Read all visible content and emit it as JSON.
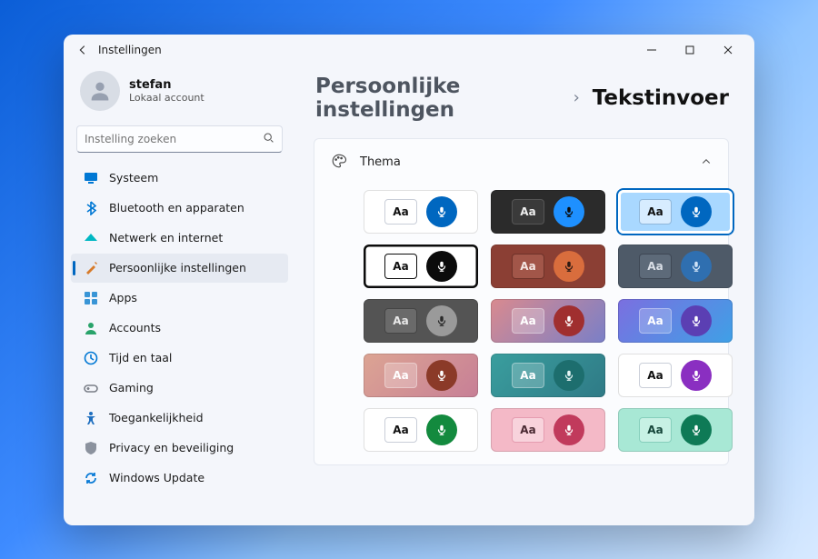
{
  "window": {
    "title": "Instellingen"
  },
  "profile": {
    "name": "stefan",
    "sub": "Lokaal account"
  },
  "search": {
    "placeholder": "Instelling zoeken"
  },
  "nav": [
    {
      "id": "systeem",
      "label": "Systeem",
      "icon": "monitor",
      "color": "#0078d4",
      "active": false
    },
    {
      "id": "bluetooth",
      "label": "Bluetooth en apparaten",
      "icon": "bluetooth",
      "color": "#0078d4",
      "active": false
    },
    {
      "id": "netwerk",
      "label": "Netwerk en internet",
      "icon": "wifi",
      "color": "#00b7c3",
      "active": false
    },
    {
      "id": "personal",
      "label": "Persoonlijke instellingen",
      "icon": "paint",
      "color": "#d77b2a",
      "active": true
    },
    {
      "id": "apps",
      "label": "Apps",
      "icon": "apps",
      "color": "#3995d6",
      "active": false
    },
    {
      "id": "accounts",
      "label": "Accounts",
      "icon": "person",
      "color": "#29a36a",
      "active": false
    },
    {
      "id": "tijd",
      "label": "Tijd en taal",
      "icon": "clock",
      "color": "#0078d4",
      "active": false
    },
    {
      "id": "gaming",
      "label": "Gaming",
      "icon": "gaming",
      "color": "#7a7f88",
      "active": false
    },
    {
      "id": "toegang",
      "label": "Toegankelijkheid",
      "icon": "access",
      "color": "#1f6fbf",
      "active": false
    },
    {
      "id": "privacy",
      "label": "Privacy en beveiliging",
      "icon": "shield",
      "color": "#8b929e",
      "active": false
    },
    {
      "id": "update",
      "label": "Windows Update",
      "icon": "update",
      "color": "#0a7bd6",
      "active": false
    }
  ],
  "breadcrumb": {
    "a": "Persoonlijke instellingen",
    "b": "Tekstinvoer"
  },
  "panel": {
    "title": "Thema"
  },
  "sample": "Aa",
  "themes": [
    {
      "bg": "#ffffff",
      "chipBg": "#ffffff",
      "chipFg": "#111",
      "chipBorder": "#c9ced8",
      "micBg": "#0067c0",
      "micFg": "#ffffff",
      "selected": false
    },
    {
      "bg": "#2b2b2b",
      "chipBg": "#3a3a3a",
      "chipFg": "#eee",
      "chipBorder": "#555",
      "micBg": "#1e90ff",
      "micFg": "#0b0b0b",
      "selected": false
    },
    {
      "bg": "#a9d8ff",
      "chipBg": "#d7ecff",
      "chipFg": "#111",
      "chipBorder": "#8fb7da",
      "micBg": "#0067c0",
      "micFg": "#ffffff",
      "selected": true
    },
    {
      "bg": "#ffffff",
      "chipBg": "#ffffff",
      "chipFg": "#111",
      "chipBorder": "#0b0b0b",
      "micBg": "#0b0b0b",
      "micFg": "#ffffff",
      "selected": false,
      "thick": true
    },
    {
      "bg": "#8b3f34",
      "chipBg": "#a25649",
      "chipFg": "#f3e6e2",
      "chipBorder": "#6e3229",
      "micBg": "#d96d3d",
      "micFg": "#2e1a13",
      "selected": false
    },
    {
      "bg": "#4e5a68",
      "chipBg": "#5d6a79",
      "chipFg": "#d9dee6",
      "chipBorder": "#3e4754",
      "micBg": "#2f6fb0",
      "micFg": "#cfe2f6",
      "selected": false
    },
    {
      "bg": "#545454",
      "chipBg": "#6a6a6a",
      "chipFg": "#e8e8e8",
      "chipBorder": "#454545",
      "micBg": "#9a9a9a",
      "micFg": "#2a2a2a",
      "selected": false
    },
    {
      "bg": "linear-gradient(135deg,#d98a8f,#7a7fc7)",
      "chipBg": "rgba(255,255,255,.25)",
      "chipFg": "#fff",
      "chipBorder": "rgba(255,255,255,.35)",
      "micBg": "#a02f2f",
      "micFg": "#ffffff",
      "selected": false
    },
    {
      "bg": "linear-gradient(135deg,#7b6fe0,#3fa0e6)",
      "chipBg": "rgba(255,255,255,.22)",
      "chipFg": "#fff",
      "chipBorder": "rgba(255,255,255,.35)",
      "micBg": "#5b3fb3",
      "micFg": "#ffffff",
      "selected": false
    },
    {
      "bg": "linear-gradient(135deg,#dca493,#c77f96)",
      "chipBg": "rgba(255,255,255,.25)",
      "chipFg": "#fff",
      "chipBorder": "rgba(255,255,255,.35)",
      "micBg": "#8b3a28",
      "micFg": "#ffffff",
      "selected": false
    },
    {
      "bg": "linear-gradient(135deg,#3a9e9e,#2f7a86)",
      "chipBg": "rgba(255,255,255,.22)",
      "chipFg": "#fff",
      "chipBorder": "rgba(255,255,255,.35)",
      "micBg": "#1d6e6e",
      "micFg": "#e6f5f5",
      "selected": false
    },
    {
      "bg": "#ffffff",
      "chipBg": "#ffffff",
      "chipFg": "#111",
      "chipBorder": "#c9ced8",
      "micBg": "#8a2fc1",
      "micFg": "#ffffff",
      "selected": false
    },
    {
      "bg": "#ffffff",
      "chipBg": "#ffffff",
      "chipFg": "#111",
      "chipBorder": "#c9ced8",
      "micBg": "#138a3e",
      "micFg": "#ffffff",
      "selected": false
    },
    {
      "bg": "#f4b9c7",
      "chipBg": "#f8d3dc",
      "chipFg": "#4a2a33",
      "chipBorder": "#e59cb0",
      "micBg": "#c13a5c",
      "micFg": "#ffffff",
      "selected": false
    },
    {
      "bg": "#a8e8d5",
      "chipBg": "#c7f1e4",
      "chipFg": "#16463a",
      "chipBorder": "#85cfbc",
      "micBg": "#0e7a56",
      "micFg": "#ffffff",
      "selected": false
    }
  ]
}
